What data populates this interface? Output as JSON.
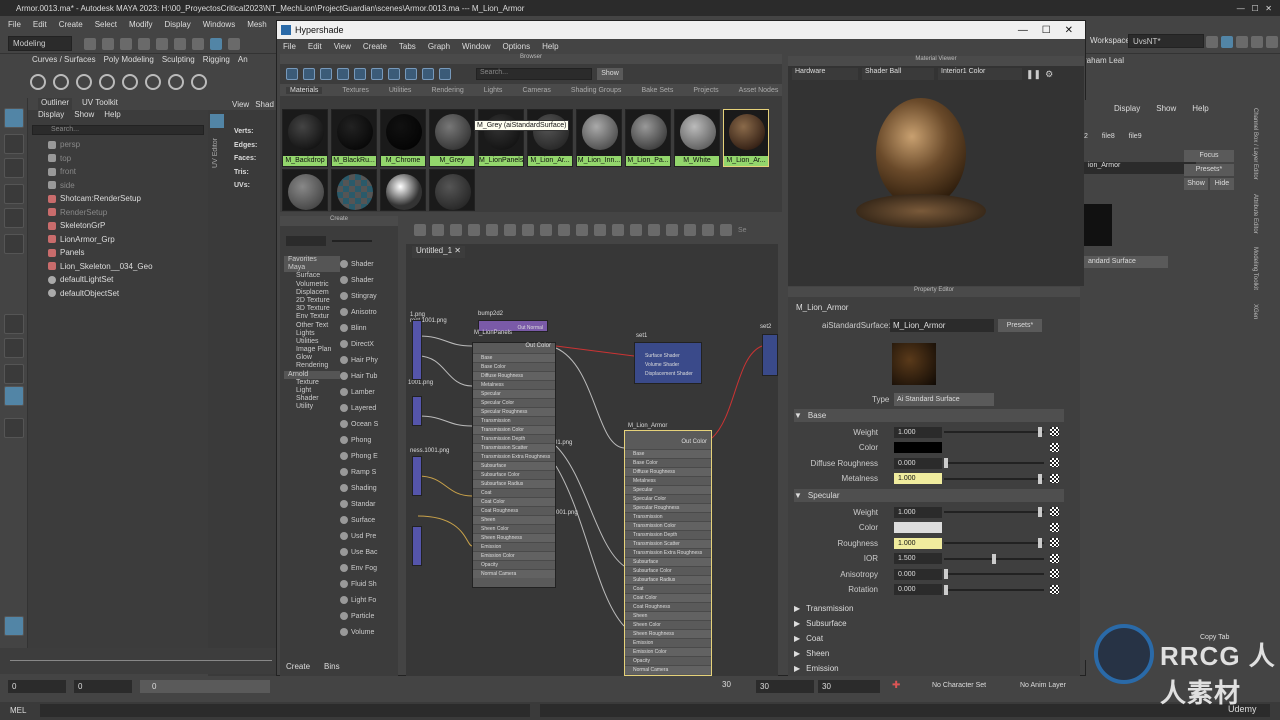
{
  "window": {
    "title": "Armor.0013.ma* - Autodesk MAYA 2023: H:\\00_ProyectosCritical2023\\NT_MechLion\\ProjectGuardian\\scenes\\Armor.0013.ma  ---  M_Lion_Armor"
  },
  "main_menu": [
    "File",
    "Edit",
    "Create",
    "Select",
    "Modify",
    "Display",
    "Windows",
    "Mesh"
  ],
  "mode_dropdown": "Modeling",
  "shelf_tabs": [
    "Curves / Surfaces",
    "Poly Modeling",
    "Sculpting",
    "Rigging",
    "An"
  ],
  "workspace": {
    "label": "Workspace:",
    "value": "UvsNT*"
  },
  "user": "raham Leal",
  "outliner": {
    "tabs": [
      "Outliner",
      "UV Toolkit"
    ],
    "menu": [
      "Display",
      "Show",
      "Help"
    ],
    "search_placeholder": "Search...",
    "items": [
      {
        "name": "persp",
        "dim": true
      },
      {
        "name": "top",
        "dim": true
      },
      {
        "name": "front",
        "dim": true
      },
      {
        "name": "side",
        "dim": true
      },
      {
        "name": "Shotcam:RenderSetup",
        "dim": false
      },
      {
        "name": "RenderSetup",
        "dim": true
      },
      {
        "name": "SkeletonGrP",
        "dim": false
      },
      {
        "name": "LionArmor_Grp",
        "dim": false
      },
      {
        "name": "Panels",
        "dim": false
      },
      {
        "name": "Lion_Skeleton__034_Geo",
        "dim": false
      },
      {
        "name": "defaultLightSet",
        "dim": false
      },
      {
        "name": "defaultObjectSet",
        "dim": false
      }
    ]
  },
  "uv_editor_label": "UV Editor",
  "viewport_menu": [
    "View",
    "Shad"
  ],
  "stats": [
    "Verts:",
    "Edges:",
    "Faces:",
    "Tris:",
    "UVs:"
  ],
  "hypershade": {
    "title": "Hypershade",
    "menu": [
      "File",
      "Edit",
      "View",
      "Create",
      "Tabs",
      "Graph",
      "Window",
      "Options",
      "Help"
    ],
    "browser": {
      "header": "Browser",
      "search_placeholder": "Search...",
      "show_button": "Show",
      "tabs": [
        "Materials",
        "Textures",
        "Utilities",
        "Rendering",
        "Lights",
        "Cameras",
        "Shading Groups",
        "Bake Sets",
        "Projects",
        "Asset Nodes"
      ],
      "materials": [
        "M_Backdrop",
        "M_BlackRu...",
        "M_Chrome",
        "M_Grey",
        "M_LionPanels",
        "M_Lion_Ar...",
        "M_Lion_Inn...",
        "M_Lion_Pa...",
        "M_White",
        "M_Lion_Ar..."
      ],
      "tooltip": "M_Grey (aiStandardSurface)"
    },
    "create": {
      "header": "Create",
      "tree": [
        "Favorites",
        "Maya",
        "Surface",
        "Volumetric",
        "Displacem",
        "2D Texture",
        "3D Texture",
        "Env Textur",
        "Other Text",
        "Lights",
        "Utilities",
        "Image Plan",
        "Glow",
        "Rendering",
        "Arnold",
        "Texture",
        "Light",
        "Shader",
        "Utility"
      ],
      "list": [
        "Shader",
        "Shader",
        "Stingray",
        "Anisotro",
        "Blinn",
        "DirectX",
        "Hair Phy",
        "Hair Tub",
        "Lamber",
        "Layered",
        "Ocean S",
        "Phong",
        "Phong E",
        "Ramp S",
        "Shading",
        "Standar",
        "Surface",
        "Usd Pre",
        "Use Bac",
        "Env Fog",
        "Fluid Sh",
        "Light Fo",
        "Particle",
        "Volume"
      ],
      "tabs": [
        "Create",
        "Bins"
      ]
    },
    "graph": {
      "tab": "Untitled_1",
      "search_placeholder": "Se",
      "nodes": {
        "bump": "bump2d2",
        "lionpanels": "M_LionPanels",
        "set1": "set1",
        "set2": "set2",
        "armor": "M_Lion_Armor",
        "out_normal": "Out Normal",
        "out_color": "Out Color",
        "set_attrs": [
          "Surface Shader",
          "Volume Shader",
          "Displacement Shader"
        ],
        "shader_attrs": [
          "Base",
          "Base Color",
          "Diffuse Roughness",
          "Metalness",
          "Specular",
          "Specular Color",
          "Specular Roughness",
          "Transmission",
          "Transmission Color",
          "Transmission Depth",
          "Transmission Scatter",
          "Transmission Extra Roughness",
          "Subsurface",
          "Subsurface Color",
          "Subsurface Radius",
          "Coat",
          "Coat Color",
          "Coat Roughness",
          "Sheen",
          "Sheen Color",
          "Sheen Roughness",
          "Emission",
          "Emission Color",
          "Opacity",
          "Normal Camera"
        ],
        "file_labels": [
          "1.png",
          "rect.1001.png",
          "1001.png",
          "ness.1001.png",
          "01.png",
          "001.png"
        ]
      }
    }
  },
  "material_viewer": {
    "header": "Material Viewer",
    "renderer": "Hardware",
    "geometry": "Shader Ball",
    "env": "Interior1 Color"
  },
  "property_editor": {
    "header": "Property Editor",
    "node_name": "M_Lion_Armor",
    "type_label": "aiStandardSurface:",
    "type_value": "M_Lion_Armor",
    "presets": "Presets*",
    "type_row_label": "Type",
    "type_row_value": "Ai Standard Surface",
    "sections_open": [
      "Base",
      "Specular"
    ],
    "base": [
      {
        "label": "Weight",
        "value": "1.000",
        "slider": 0.98,
        "hl": false
      },
      {
        "label": "Color",
        "value": "",
        "slider": null,
        "hl": false
      },
      {
        "label": "Diffuse Roughness",
        "value": "0.000",
        "slider": 0.0,
        "hl": false
      },
      {
        "label": "Metalness",
        "value": "1.000",
        "slider": 0.98,
        "hl": true
      }
    ],
    "specular": [
      {
        "label": "Weight",
        "value": "1.000",
        "slider": 0.98,
        "hl": false
      },
      {
        "label": "Color",
        "value": "",
        "slider": null,
        "hl": false
      },
      {
        "label": "Roughness",
        "value": "1.000",
        "slider": 0.98,
        "hl": true
      },
      {
        "label": "IOR",
        "value": "1.500",
        "slider": 0.5,
        "hl": false
      },
      {
        "label": "Anisotropy",
        "value": "0.000",
        "slider": 0.0,
        "hl": false
      },
      {
        "label": "Rotation",
        "value": "0.000",
        "slider": 0.0,
        "hl": false
      }
    ],
    "sections_closed": [
      "Transmission",
      "Subsurface",
      "Coat",
      "Sheen",
      "Emission"
    ]
  },
  "channel_box": {
    "menu": [
      "Display",
      "Show",
      "Help"
    ],
    "tabs": [
      "2",
      "file8",
      "file9"
    ],
    "name": "ion_Armor",
    "focus": "Focus",
    "presets": "Presets*",
    "show": "Show",
    "hide": "Hide",
    "type": "andard Surface",
    "copy_tab": "Copy Tab",
    "side_labels": [
      "Channel Box / Layer Editor",
      "Attribute Editor",
      "Modeling Toolkit",
      "XGen"
    ]
  },
  "status": {
    "start": "0",
    "start2": "0",
    "range_start": "0",
    "frame": "30",
    "end1": "30",
    "end2": "30",
    "character_set": "No Character Set",
    "anim_layer": "No Anim Layer",
    "mel": "MEL"
  },
  "watermark": "RRCG 人人素材",
  "udemy": "Udemy"
}
